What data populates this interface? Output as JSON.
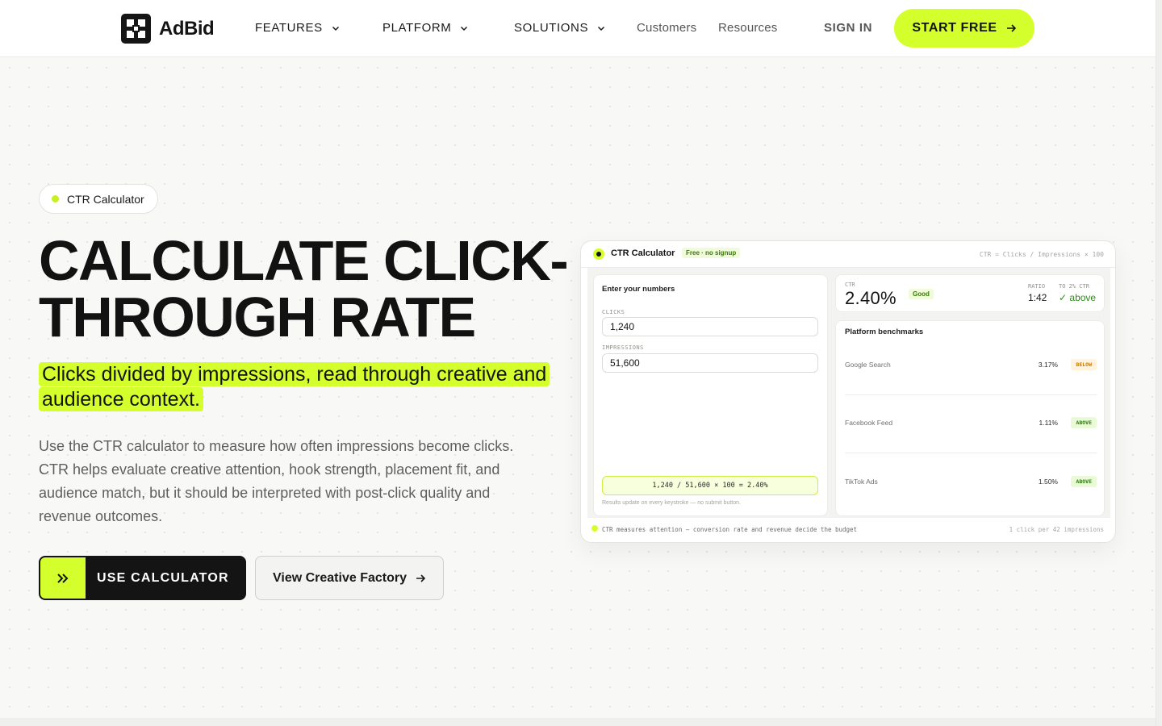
{
  "nav": {
    "logo_text": "AdBid",
    "links": [
      {
        "label": "FEATURES",
        "has_dropdown": true
      },
      {
        "label": "PLATFORM",
        "has_dropdown": true
      },
      {
        "label": "SOLUTIONS",
        "has_dropdown": true
      },
      {
        "label": "Customers",
        "has_dropdown": false
      },
      {
        "label": "Resources",
        "has_dropdown": false
      }
    ],
    "sign_in": "SIGN IN",
    "cta": "START FREE"
  },
  "hero": {
    "pill": "CTR Calculator",
    "title": "CALCULATE CLICK-THROUGH RATE",
    "highlight": "Clicks divided by impressions, read through creative and audience context.",
    "description": "Use the CTR calculator to measure how often impressions become clicks. CTR helps evaluate creative attention, hook strength, placement fit, and audience match, but it should be interpreted with post-click quality and revenue outcomes.",
    "primary_button": "USE CALCULATOR",
    "secondary_button": "View Creative Factory"
  },
  "calculator": {
    "title": "CTR Calculator",
    "badge": "Free · no signup",
    "formula": "CTR = Clicks / Impressions × 100",
    "inputs_title": "Enter your numbers",
    "clicks_label": "CLICKS",
    "clicks_value": "1,240",
    "impressions_label": "IMPRESSIONS",
    "impressions_value": "51,600",
    "result_formula": "1,240 / 51,600 × 100 = 2.40%",
    "result_note": "Results update on every keystroke — no submit button.",
    "ctr_label": "CTR",
    "ctr_value": "2.40%",
    "ctr_rating": "Good",
    "ratio_label": "RATIO",
    "ratio_value": "1:42",
    "to_label": "TO 2% CTR",
    "to_value": "✓ above",
    "benchmarks_title": "Platform benchmarks",
    "benchmarks": [
      {
        "name": "Google Search",
        "value": "3.17%",
        "status": "BELOW"
      },
      {
        "name": "Facebook Feed",
        "value": "1.11%",
        "status": "ABOVE"
      },
      {
        "name": "TikTok Ads",
        "value": "1.50%",
        "status": "ABOVE"
      }
    ],
    "footer_left": "CTR measures attention — conversion rate and revenue decide the budget",
    "footer_right": "1 click per 42 impressions"
  },
  "colors": {
    "accent": "#d5ff2c",
    "dark": "#141414",
    "positive": "#2e8a19",
    "warning": "#c97a00"
  }
}
